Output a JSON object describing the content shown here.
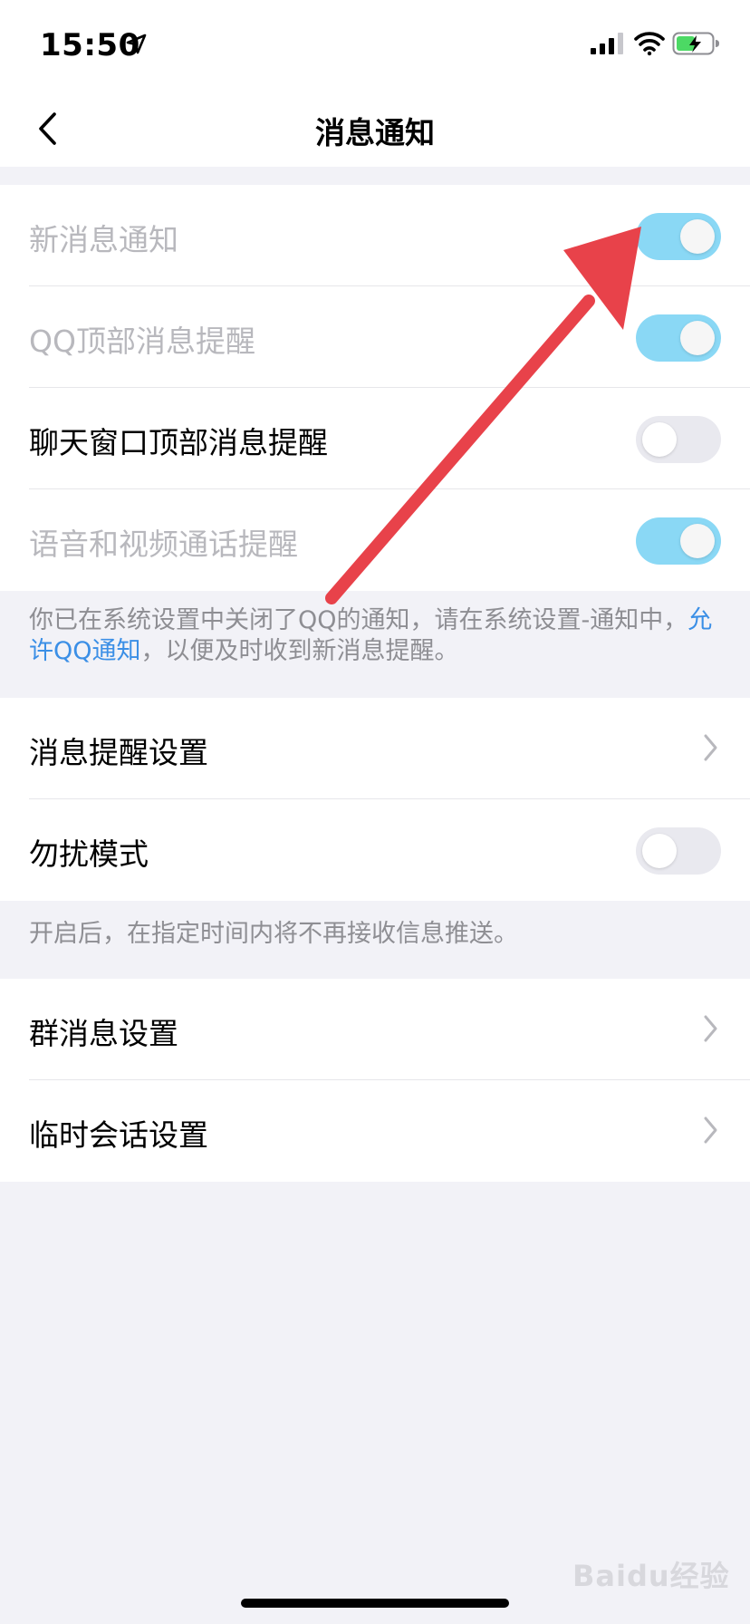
{
  "status_bar": {
    "time": "15:50"
  },
  "nav": {
    "title": "消息通知"
  },
  "group1": {
    "rows": [
      {
        "label": "新消息通知",
        "toggle": "on",
        "dim": true
      },
      {
        "label": "QQ顶部消息提醒",
        "toggle": "on",
        "dim": true
      },
      {
        "label": "聊天窗口顶部消息提醒",
        "toggle": "off",
        "dim": false
      },
      {
        "label": "语音和视频通话提醒",
        "toggle": "on",
        "dim": true
      }
    ]
  },
  "note1": {
    "text_before": "你已在系统设置中关闭了QQ的通知，请在系统设置-通知中，",
    "link": "允许QQ通知",
    "text_after": "，以便及时收到新消息提醒。"
  },
  "group2": {
    "rows": [
      {
        "label": "消息提醒设置",
        "control": "chevron"
      },
      {
        "label": "勿扰模式",
        "control": "toggle",
        "toggle": "off"
      }
    ]
  },
  "note2": {
    "text": "开启后，在指定时间内将不再接收信息推送。"
  },
  "group3": {
    "rows": [
      {
        "label": "群消息设置",
        "control": "chevron"
      },
      {
        "label": "临时会话设置",
        "control": "chevron"
      }
    ]
  },
  "watermark": "Baidu经验",
  "colors": {
    "toggle_on": "#8ad8f5",
    "toggle_off": "#e9e9ef",
    "link": "#3b8fe6",
    "arrow": "#e8424a"
  },
  "icons": [
    "location-arrow-icon",
    "signal-icon",
    "wifi-icon",
    "battery-charging-icon",
    "back-chevron-icon",
    "chevron-right-icon"
  ]
}
